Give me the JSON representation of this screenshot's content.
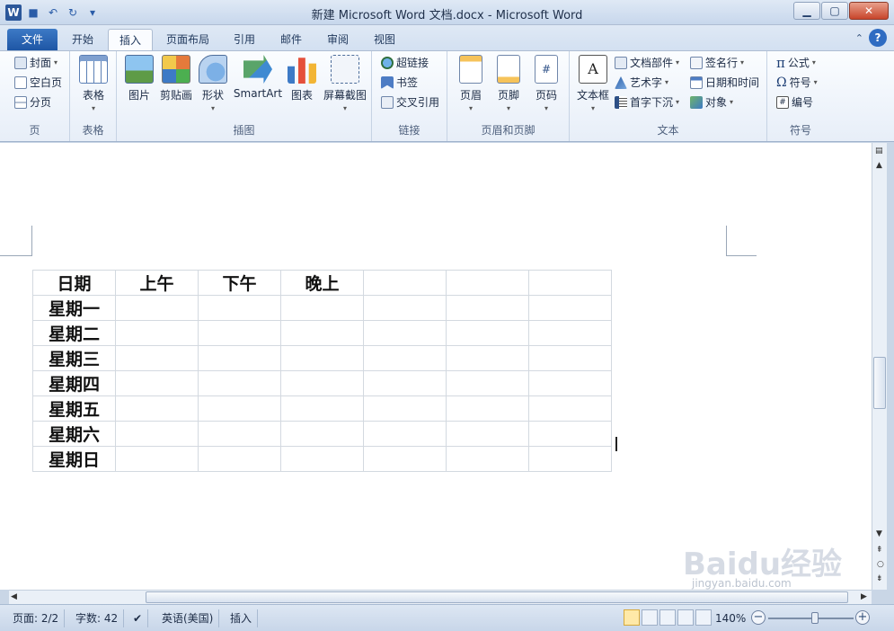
{
  "window": {
    "title": "新建 Microsoft Word 文档.docx - Microsoft Word"
  },
  "tabs": [
    "文件",
    "开始",
    "插入",
    "页面布局",
    "引用",
    "邮件",
    "审阅",
    "视图"
  ],
  "active_tab": "插入",
  "ribbon": {
    "groups": {
      "page": {
        "label": "页",
        "buttons": [
          "封面",
          "空白页",
          "分页"
        ]
      },
      "table": {
        "label": "表格",
        "buttons": [
          "表格"
        ]
      },
      "illustrations": {
        "label": "插图",
        "buttons": [
          "图片",
          "剪贴画",
          "形状",
          "SmartArt",
          "图表",
          "屏幕截图"
        ]
      },
      "links": {
        "label": "链接",
        "buttons": [
          "超链接",
          "书签",
          "交叉引用"
        ]
      },
      "header_footer": {
        "label": "页眉和页脚",
        "buttons": [
          "页眉",
          "页脚",
          "页码"
        ]
      },
      "text": {
        "label": "文本",
        "big_button": "文本框",
        "buttons": [
          "文档部件",
          "艺术字",
          "首字下沉",
          "签名行",
          "日期和时间",
          "对象"
        ]
      },
      "symbols": {
        "label": "符号",
        "buttons": [
          "公式",
          "符号",
          "编号"
        ]
      }
    }
  },
  "document": {
    "table": {
      "header": [
        "日期",
        "上午",
        "下午",
        "晚上",
        "",
        "",
        ""
      ],
      "rows": [
        [
          "星期一",
          "",
          "",
          "",
          "",
          "",
          ""
        ],
        [
          "星期二",
          "",
          "",
          "",
          "",
          "",
          ""
        ],
        [
          "星期三",
          "",
          "",
          "",
          "",
          "",
          ""
        ],
        [
          "星期四",
          "",
          "",
          "",
          "",
          "",
          ""
        ],
        [
          "星期五",
          "",
          "",
          "",
          "",
          "",
          ""
        ],
        [
          "星期六",
          "",
          "",
          "",
          "",
          "",
          ""
        ],
        [
          "星期日",
          "",
          "",
          "",
          "",
          "",
          ""
        ]
      ]
    }
  },
  "statusbar": {
    "page": "页面: 2/2",
    "words": "字数: 42",
    "language": "英语(美国)",
    "mode": "插入",
    "zoom": "140%"
  },
  "watermark": {
    "main": "Baidu经验",
    "sub": "jingyan.baidu.com"
  }
}
